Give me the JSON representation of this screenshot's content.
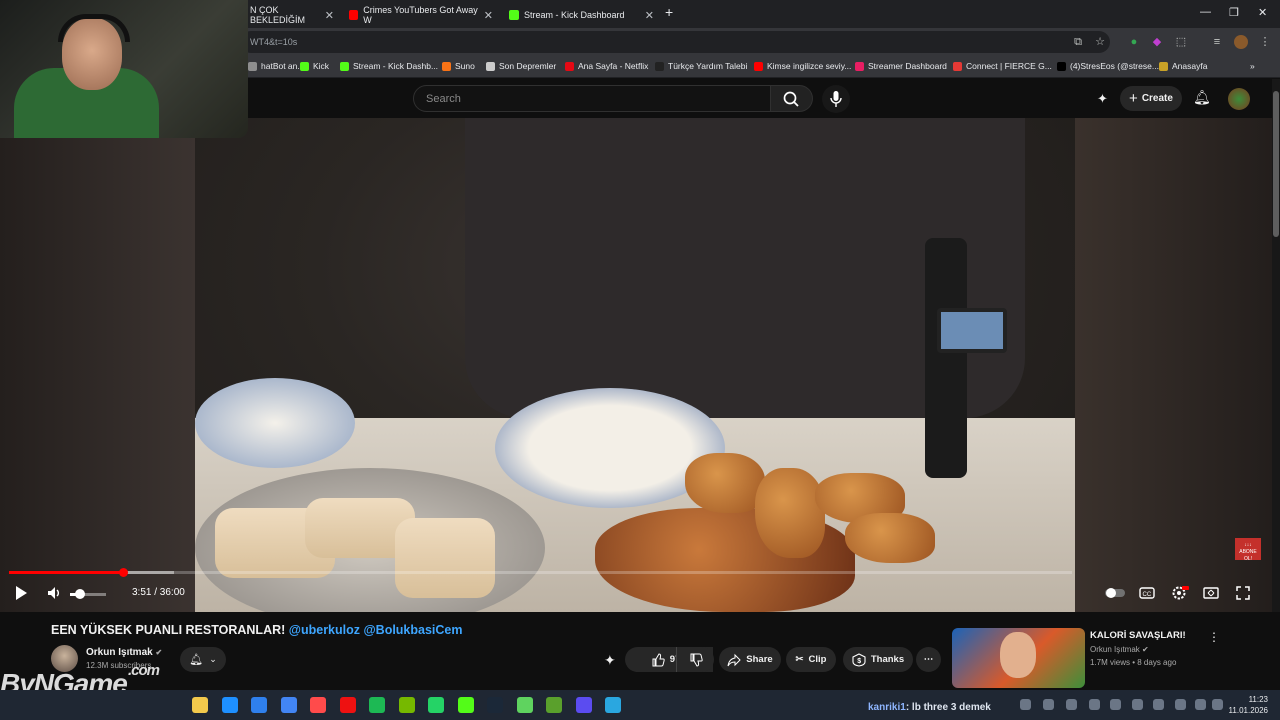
{
  "browser": {
    "tabs": [
      {
        "title": "N ÇOK BEKLEDİĞİM",
        "favicon_color": "#202124"
      },
      {
        "title": "Crimes YouTubers Got Away W",
        "favicon_color": "#ff0000"
      },
      {
        "title": "Stream - Kick Dashboard",
        "favicon_color": "#53fc18"
      }
    ],
    "new_tab": "+",
    "url": "WT4&t=10s",
    "bookmarks": [
      {
        "label": "hatBot an...",
        "color": "#8e8e8e"
      },
      {
        "label": "Kick",
        "color": "#53fc18"
      },
      {
        "label": "Stream - Kick Dashb...",
        "color": "#53fc18"
      },
      {
        "label": "Suno",
        "color": "#f97316"
      },
      {
        "label": "Son Depremler",
        "color": "#cccccc"
      },
      {
        "label": "Ana Sayfa - Netflix",
        "color": "#e50914"
      },
      {
        "label": "Türkçe Yardım Talebi",
        "color": "#222222"
      },
      {
        "label": "Kimse ingilizce seviy...",
        "color": "#ff0000"
      },
      {
        "label": "Streamer Dashboard",
        "color": "#e91e63"
      },
      {
        "label": "Connect | FIERCE G...",
        "color": "#e53935"
      },
      {
        "label": "(4)StresEos (@strese...",
        "color": "#000000"
      },
      {
        "label": "Anasayfa",
        "color": "#c9a227"
      }
    ]
  },
  "youtube": {
    "search_placeholder": "Search",
    "create_label": "Create"
  },
  "player": {
    "current_time": "3:51 / 36:00",
    "played_fraction": 0.107,
    "loaded_fraction": 0.155,
    "volume_fraction": 0.2,
    "overlay_badge": "↓↓↓ ABONE OL!"
  },
  "video": {
    "title_main": "EEN YÜKSEK PUANLI RESTORANLAR!",
    "title_tags": "@uberkuloz @BolukbasiCem",
    "channel": "Orkun Işıtmak",
    "verified": "✔",
    "subscribers": "12.3M subscribers",
    "likes": "97K",
    "share": "Share",
    "clip": "Clip",
    "thanks": "Thanks",
    "more": "⋯"
  },
  "suggestion": {
    "title": "KALORİ SAVAŞLARI!",
    "channel": "Orkun Işıtmak",
    "meta": "1.7M views • 8 days ago"
  },
  "watermark": {
    "text": "ByNGame",
    "suffix": ".com"
  },
  "taskbar": {
    "chat_user": "kanriki1",
    "chat_text": ": lb three 3 demek",
    "time": "11:23",
    "date": "11.01.2026",
    "apps": [
      "#f2c94c",
      "#1e90ff",
      "#2f80ed",
      "#4285f4",
      "#ff4b4b",
      "#e11",
      "#1db954",
      "#76b900",
      "#25d366",
      "#53fc18",
      "#1b2838",
      "#5fd35f",
      "#5aa02c",
      "#5b4cf0",
      "#2aa7e0"
    ]
  }
}
